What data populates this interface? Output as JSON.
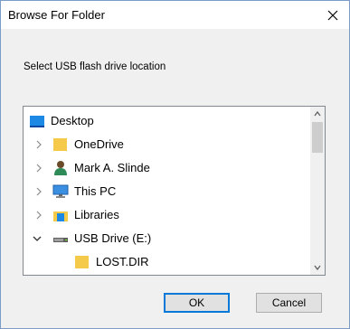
{
  "window": {
    "title": "Browse For Folder"
  },
  "instruction": "Select USB flash drive location",
  "tree": {
    "items": [
      {
        "label": "Desktop",
        "icon": "desktop-icon",
        "chevron": "none"
      },
      {
        "label": "OneDrive",
        "icon": "folder-icon",
        "chevron": "right"
      },
      {
        "label": "Mark A. Slinde",
        "icon": "user-icon",
        "chevron": "right"
      },
      {
        "label": "This PC",
        "icon": "computer-icon",
        "chevron": "right"
      },
      {
        "label": "Libraries",
        "icon": "libraries-icon",
        "chevron": "right"
      },
      {
        "label": "USB Drive (E:)",
        "icon": "usb-drive-icon",
        "chevron": "down"
      },
      {
        "label": "LOST.DIR",
        "icon": "folder-icon",
        "chevron": "none"
      }
    ]
  },
  "buttons": {
    "ok": "OK",
    "cancel": "Cancel"
  },
  "colors": {
    "accent": "#0078d7",
    "folder": "#f5c94a"
  }
}
